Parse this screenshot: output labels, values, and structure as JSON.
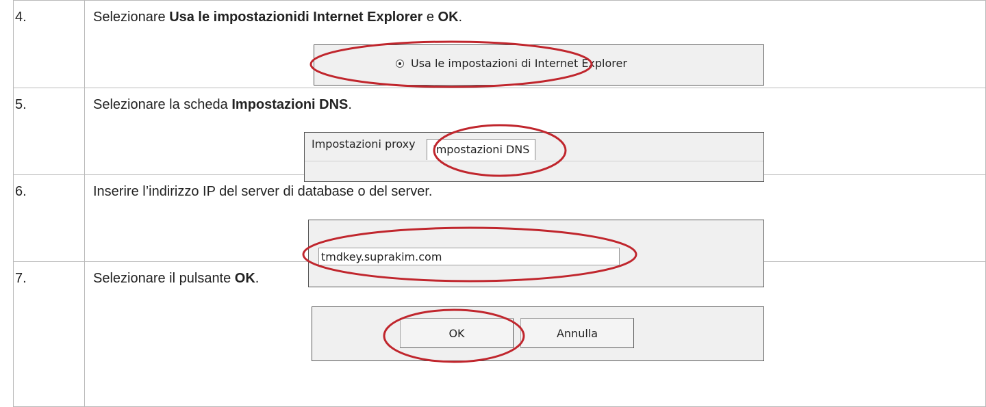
{
  "steps": [
    {
      "number": "4.",
      "instruction": {
        "pre": "Selezionare ",
        "bold1": "Usa le impostazionidi Internet Explorer",
        "mid": " e ",
        "bold2": "OK",
        "post": "."
      },
      "screenshot": {
        "radio_label": "Usa le impostazioni di Internet Explorer",
        "radio_selected": true
      }
    },
    {
      "number": "5.",
      "instruction": {
        "pre": "Selezionare la scheda ",
        "bold1": "Impostazioni DNS",
        "post": "."
      },
      "screenshot": {
        "tab_proxy": "Impostazioni proxy",
        "tab_dns": "Impostazioni DNS"
      }
    },
    {
      "number": "6.",
      "instruction": {
        "text": "Inserire l’indirizzo IP del server di database o del server."
      },
      "screenshot": {
        "server_value": "tmdkey.suprakim.com"
      }
    },
    {
      "number": "7.",
      "instruction": {
        "pre": "Selezionare il pulsante ",
        "bold1": "OK",
        "post": "."
      },
      "screenshot": {
        "ok_label": "OK",
        "cancel_label": "Annulla"
      }
    }
  ],
  "colors": {
    "callout": "#c0262d",
    "border": "#b9b9b9",
    "dialog_bg": "#f0f0f0"
  }
}
